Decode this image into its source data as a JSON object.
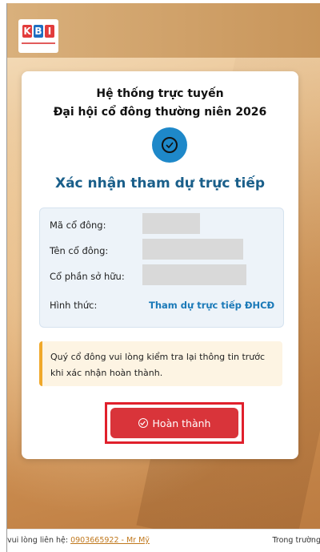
{
  "brand": {
    "letters": [
      "K",
      "B",
      "I"
    ],
    "colors": [
      "#e23c3c",
      "#1e6fc2",
      "#e23c3c"
    ]
  },
  "card": {
    "title_line1": "Hệ thống trực tuyến",
    "title_line2": "Đại hội cổ đông thường niên 2026",
    "status_icon": "check-circle-icon",
    "confirm_title": "Xác nhận tham dự trực tiếp"
  },
  "info": {
    "shareholder_code_label": "Mã cổ đông:",
    "shareholder_name_label": "Tên cổ đông:",
    "shares_owned_label": "Cổ phần sở hữu:",
    "attendance_type_label": "Hình thức:",
    "attendance_type_value": "Tham dự trực tiếp ĐHCĐ"
  },
  "notice": {
    "text": "Quý cổ đông vui lòng kiểm tra lại thông tin trước khi xác nhận hoàn thành."
  },
  "actions": {
    "complete_label": "Hoàn thành",
    "complete_icon": "check-circle-icon"
  },
  "footer": {
    "contact_prefix": "vui lòng liên hệ: ",
    "contact_link": "0903665922 - Mr Mỹ",
    "right_text": "Trong trường"
  },
  "colors": {
    "primary": "#1e88c9",
    "button": "#d9343a",
    "highlight": "#e0202c",
    "notice_border": "#f0a82a"
  }
}
